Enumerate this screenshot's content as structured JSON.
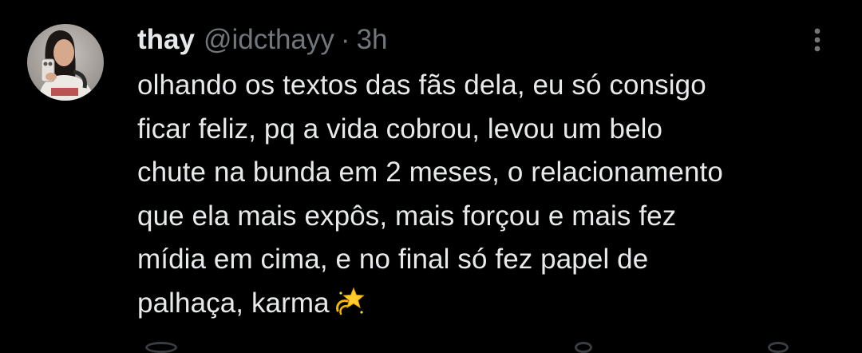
{
  "tweet": {
    "display_name": "thay",
    "handle": "@idcthayy",
    "separator": "·",
    "time": "3h",
    "text": "olhando os textos das fãs dela, eu só consigo\nficar feliz, pq a vida cobrou, levou um belo\nchute na bunda em 2 meses, o relacionamento\nque ela mais expôs, mais forçou e mais fez\nmídia em cima, e no final só fez papel de\npalhaça, karma",
    "emoji": "dizzy-emoji"
  },
  "icons": {
    "more": "more-vertical-icon",
    "avatar": "profile-avatar"
  },
  "colors": {
    "background": "#000000",
    "primary_text": "#e7e9ea",
    "secondary_text": "#71767b",
    "emoji_gold": "#f5b700"
  }
}
